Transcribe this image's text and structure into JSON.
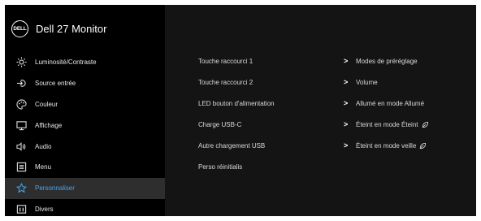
{
  "header": {
    "logo_text": "DELL",
    "title": "Dell 27 Monitor"
  },
  "sidebar": {
    "items": [
      {
        "label": "Luminosité/Contraste",
        "icon": "brightness-icon"
      },
      {
        "label": "Source entrée",
        "icon": "input-source-icon"
      },
      {
        "label": "Couleur",
        "icon": "color-palette-icon"
      },
      {
        "label": "Affichage",
        "icon": "display-icon"
      },
      {
        "label": "Audio",
        "icon": "speaker-icon"
      },
      {
        "label": "Menu",
        "icon": "menu-icon"
      },
      {
        "label": "Personnaliser",
        "icon": "star-icon",
        "active": true
      },
      {
        "label": "Divers",
        "icon": "info-icon"
      }
    ]
  },
  "content": {
    "rows": [
      {
        "label": "Touche raccourci 1",
        "value": "Modes de préréglage",
        "has_chevron": true
      },
      {
        "label": "Touche raccourci 2",
        "value": "Volume",
        "has_chevron": true
      },
      {
        "label": "LED bouton d'alimentation",
        "value": "Allumé en mode Allumé",
        "has_chevron": true
      },
      {
        "label": "Charge USB-C",
        "value": "Éteint en mode Éteint",
        "has_chevron": true,
        "value_icon": "eco-leaf-icon"
      },
      {
        "label": "Autre chargement USB",
        "value": "Éteint en mode veille",
        "has_chevron": true,
        "value_icon": "eco-leaf-icon"
      },
      {
        "label": "Perso réinitialis",
        "value": "",
        "has_chevron": false
      }
    ],
    "chevron": ">"
  },
  "colors": {
    "sidebar_bg": "#000000",
    "content_bg": "#141414",
    "active_bg": "#2e2e2e",
    "active_text": "#4aa3e6",
    "text": "#d9d9d9"
  }
}
